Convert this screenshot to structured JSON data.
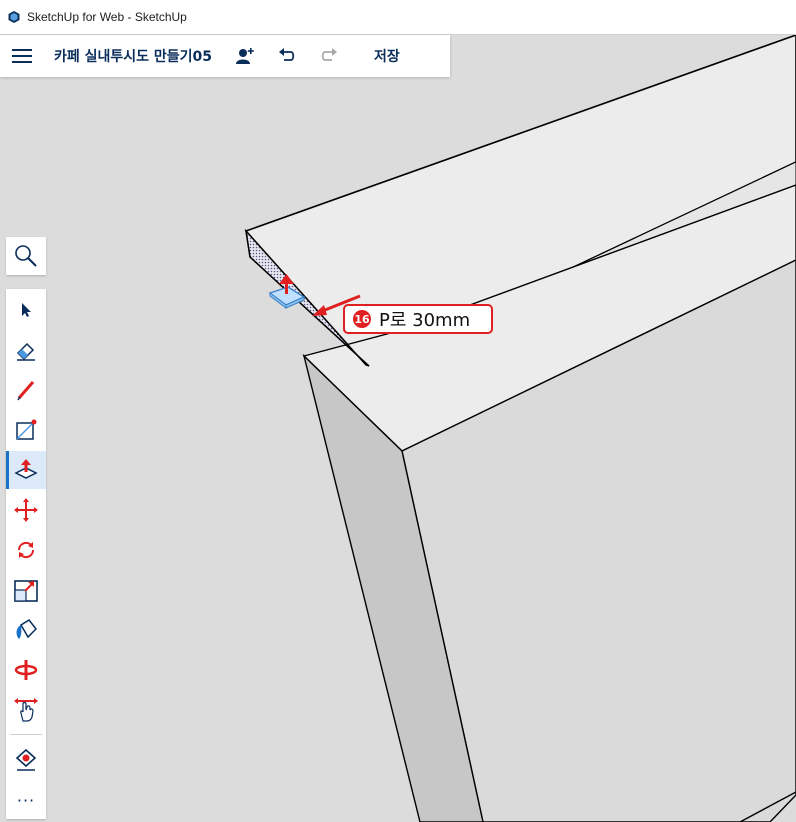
{
  "window": {
    "title": "SketchUp for Web - SketchUp"
  },
  "header": {
    "doc_title": "카페 실내투시도 만들기05",
    "save_label": "저장"
  },
  "callout": {
    "number": "16",
    "text": "P로 30mm"
  },
  "toolbar": {
    "tools": [
      {
        "name": "select",
        "icon": "select-arrow-icon"
      },
      {
        "name": "eraser",
        "icon": "eraser-icon"
      },
      {
        "name": "pencil",
        "icon": "pencil-icon"
      },
      {
        "name": "rectangle",
        "icon": "rectangle-icon"
      },
      {
        "name": "push-pull",
        "icon": "push-pull-icon",
        "active": true
      },
      {
        "name": "move",
        "icon": "move-icon"
      },
      {
        "name": "rotate",
        "icon": "rotate-icon"
      },
      {
        "name": "scale",
        "icon": "scale-icon"
      },
      {
        "name": "paint",
        "icon": "paint-bucket-icon"
      },
      {
        "name": "orbit",
        "icon": "orbit-icon"
      },
      {
        "name": "pan",
        "icon": "pan-hand-icon"
      },
      {
        "name": "tape",
        "icon": "tape-measure-icon"
      },
      {
        "name": "more",
        "icon": "more-icon"
      }
    ]
  },
  "colors": {
    "accent": "#1a73c8",
    "brand_navy": "#0a2d5a",
    "callout_red": "#e02020",
    "viewport_bg": "#dcdcdc"
  }
}
